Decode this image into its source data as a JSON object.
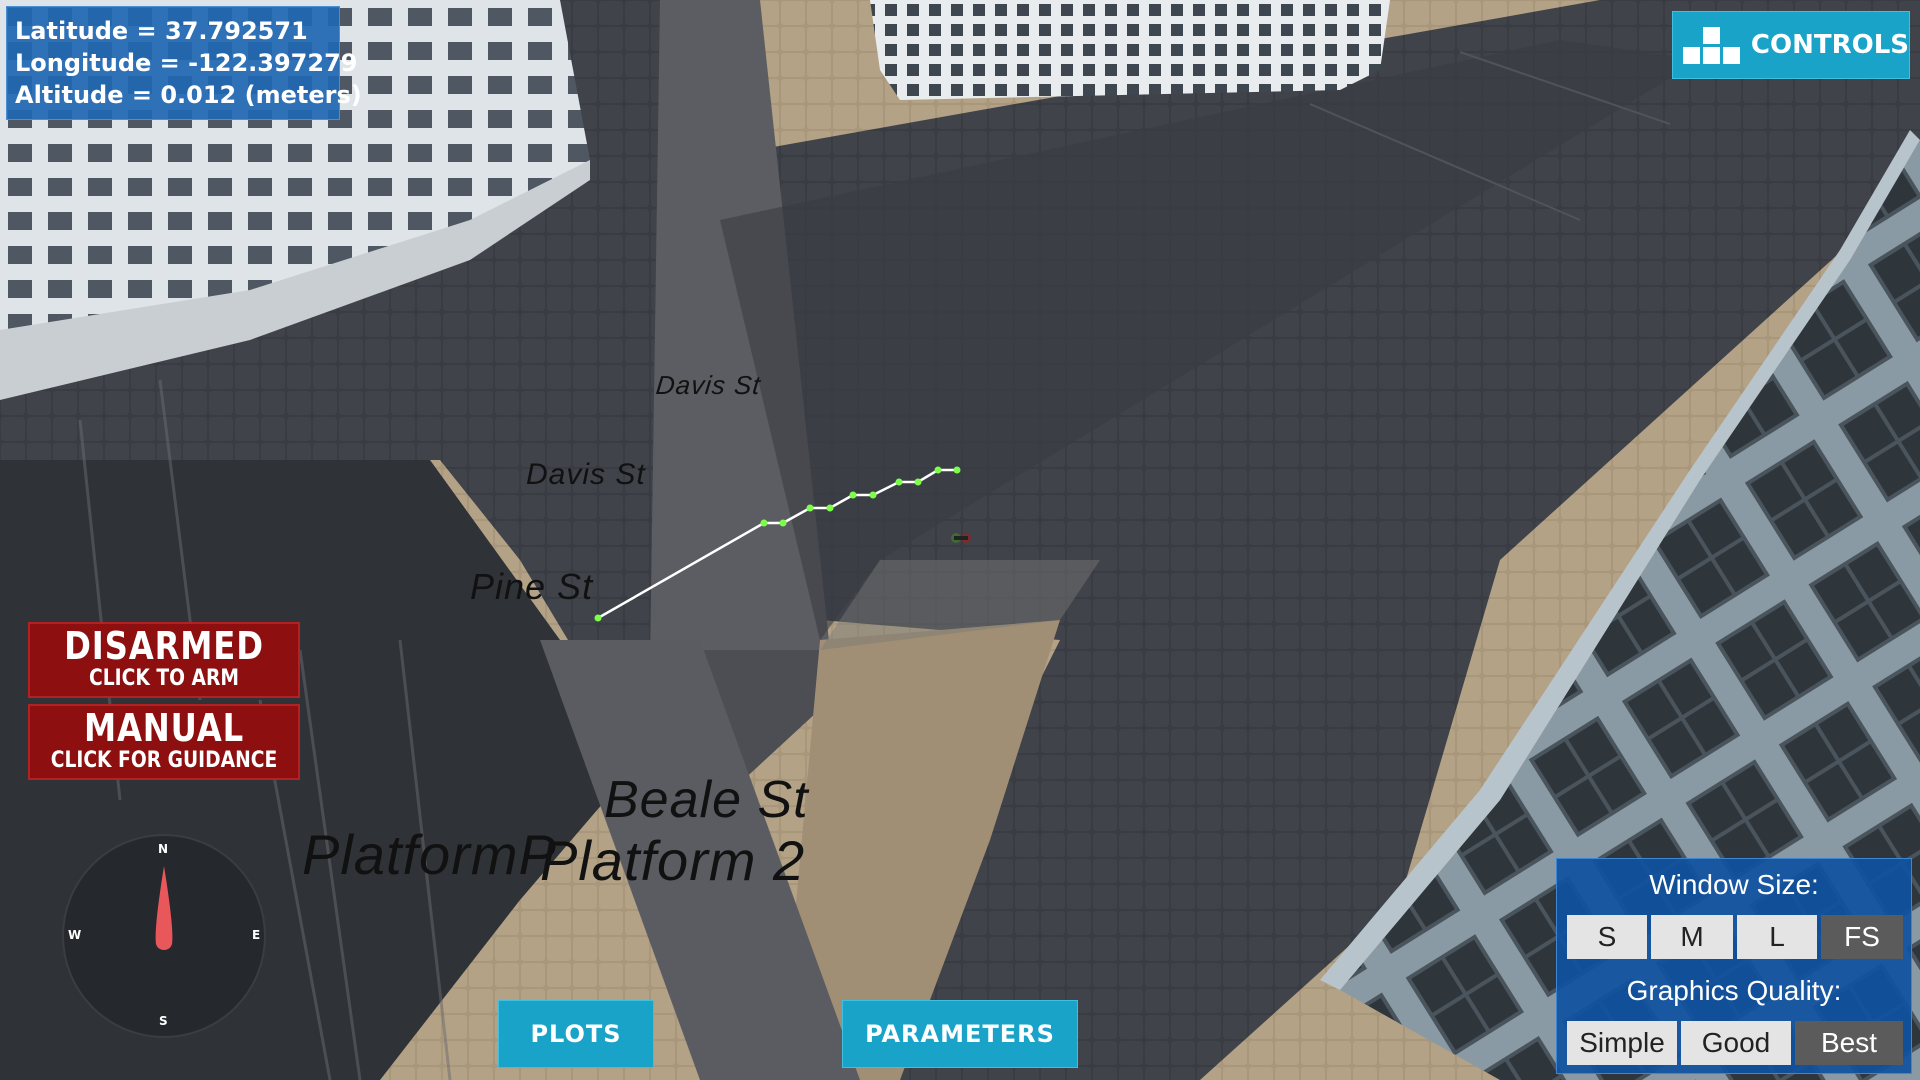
{
  "gps": {
    "latitude": "Latitude = 37.792571",
    "longitude": "Longitude = -122.397279",
    "altitude": "Altitude = 0.012 (meters)"
  },
  "controls_label": "CONTROLS",
  "arm_status": {
    "title": "DISARMED",
    "subtitle": "CLICK TO ARM"
  },
  "mode_status": {
    "title": "MANUAL",
    "subtitle": "CLICK FOR GUIDANCE"
  },
  "compass": {
    "north": "N",
    "south": "S",
    "east": "E",
    "west": "W",
    "heading_icon": "compass-needle-icon"
  },
  "street_labels": {
    "davis_1": "Davis St",
    "davis_2": "Davis St",
    "pine": "Pine St",
    "beale": "Beale St",
    "platform_1": "PlatformP",
    "platform_2": "Platform 2"
  },
  "bottom_buttons": {
    "plots": "PLOTS",
    "parameters": "PARAMETERS"
  },
  "window_size": {
    "title": "Window Size:",
    "options": [
      "S",
      "M",
      "L",
      "FS"
    ],
    "selected": "FS"
  },
  "graphics_quality": {
    "title": "Graphics Quality:",
    "options": [
      "Simple",
      "Good",
      "Best"
    ],
    "selected": "Best"
  },
  "colors": {
    "panel_blue": "#2067b2",
    "button_cyan": "#1aa3c8",
    "alert_red": "#8d0f0f",
    "path_green": "#7cff4a",
    "path_white": "#ffffff"
  }
}
